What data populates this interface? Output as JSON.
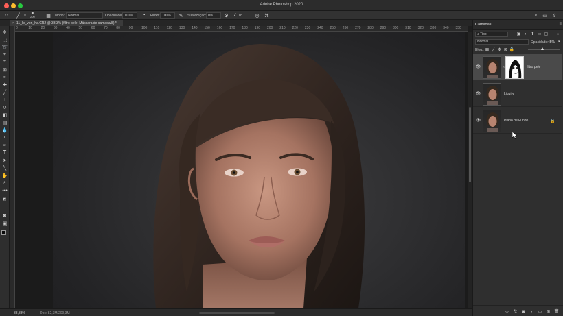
{
  "window": {
    "app_title": "Adobe Photoshop 2020"
  },
  "options_bar": {
    "brush_size": "200",
    "mode_label": "Modo:",
    "mode_value": "Normal",
    "opacity_label": "Opacidade:",
    "opacity_value": "100%",
    "flow_label": "Fluxo:",
    "flow_value": "100%",
    "smoothing_label": "Suavização:",
    "smoothing_value": "0%",
    "angle_value": "0°"
  },
  "document": {
    "tab_title": "11_lis_von_ha.CR2 @ 33,3% (filtro pele, Máscara de camada/8) *",
    "tab_close": "×"
  },
  "ruler": {
    "ticks": [
      "0",
      "10",
      "20",
      "30",
      "40",
      "50",
      "60",
      "70",
      "80",
      "90",
      "100",
      "110",
      "120",
      "130",
      "140",
      "150",
      "160",
      "170",
      "180",
      "190",
      "200",
      "210",
      "220",
      "230",
      "240",
      "250",
      "260",
      "270",
      "280",
      "290",
      "300",
      "310",
      "320",
      "330",
      "340",
      "350",
      "360"
    ]
  },
  "status_bar": {
    "zoom": "33,33%",
    "doc_info": "Doc: 82,3M/209,3M"
  },
  "layers_panel": {
    "title": "Camadas",
    "filter_kind": "Tipo",
    "blend_mode": "Normal",
    "opacity_label": "Opacidade:",
    "opacity_value": "45%",
    "lock_label": "Bloq.:",
    "fill_label": "Preench.:",
    "fill_value": "100%",
    "opacity_fraction": 0.45,
    "layers": [
      {
        "name": "filtro pele",
        "visible": true,
        "selected": true,
        "has_mask": true
      },
      {
        "name": "Liquify",
        "visible": true,
        "selected": false,
        "has_mask": false
      },
      {
        "name": "Plano de Fundo",
        "visible": true,
        "selected": false,
        "has_mask": false,
        "locked": true
      }
    ]
  },
  "icons": {
    "home": "home-icon",
    "brush": "brush-icon",
    "search": "search-icon",
    "workspace": "workspace-icon",
    "share": "share-icon"
  }
}
